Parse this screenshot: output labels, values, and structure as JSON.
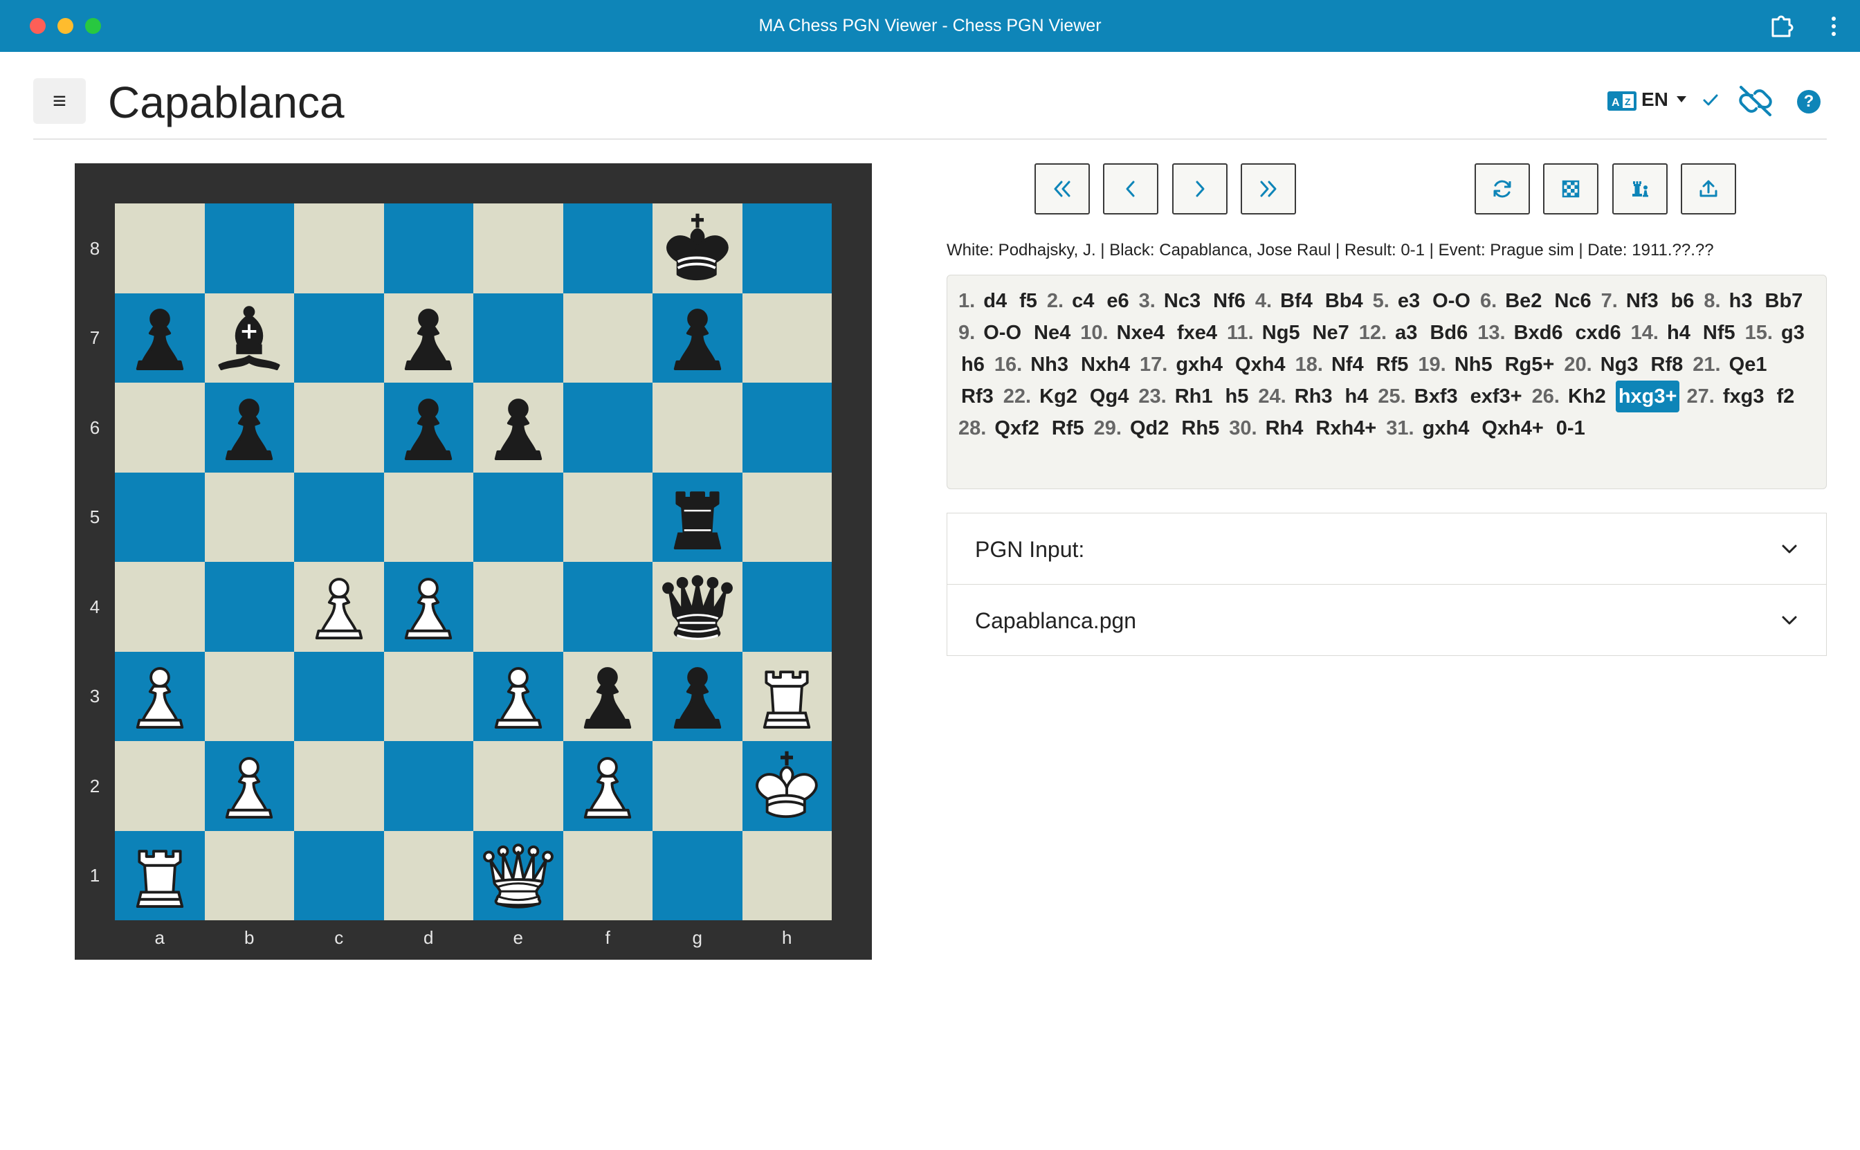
{
  "window": {
    "title": "MA Chess PGN Viewer - Chess PGN Viewer"
  },
  "header": {
    "menu_glyph": "≡",
    "title": "Capablanca",
    "language": "EN",
    "help_glyph": "?"
  },
  "board": {
    "files": [
      "a",
      "b",
      "c",
      "d",
      "e",
      "f",
      "g",
      "h"
    ],
    "ranks": [
      "8",
      "7",
      "6",
      "5",
      "4",
      "3",
      "2",
      "1"
    ],
    "pieces": {
      "g8": "bK",
      "a7": "bP",
      "b7": "bB",
      "d7": "bP",
      "g7": "bP",
      "b6": "bP",
      "d6": "bP",
      "e6": "bP",
      "g5": "bR",
      "c4": "wP",
      "d4": "wP",
      "g4": "bQ",
      "a3": "wP",
      "e3": "wP",
      "f3": "bP",
      "g3": "bP",
      "h3": "wR",
      "b2": "wP",
      "f2": "wP",
      "h2": "wK",
      "a1": "wR",
      "e1": "wQ"
    },
    "colors": {
      "light": "#dcdcc8",
      "dark": "#0c82b8",
      "frame": "#303030"
    }
  },
  "toolbar": {
    "buttons": [
      "first-move",
      "previous-move",
      "next-move",
      "last-move",
      "flip-board",
      "board-theme",
      "piece-set",
      "export"
    ]
  },
  "game_info": "White: Podhajsky, J. | Black: Capablanca, Jose Raul | Result: 0-1 | Event: Prague sim | Date: 1911.??.??",
  "moves": [
    {
      "n": "1.",
      "w": "d4",
      "b": "f5"
    },
    {
      "n": "2.",
      "w": "c4",
      "b": "e6"
    },
    {
      "n": "3.",
      "w": "Nc3",
      "b": "Nf6"
    },
    {
      "n": "4.",
      "w": "Bf4",
      "b": "Bb4"
    },
    {
      "n": "5.",
      "w": "e3",
      "b": "O-O"
    },
    {
      "n": "6.",
      "w": "Be2",
      "b": "Nc6"
    },
    {
      "n": "7.",
      "w": "Nf3",
      "b": "b6"
    },
    {
      "n": "8.",
      "w": "h3",
      "b": "Bb7"
    },
    {
      "n": "9.",
      "w": "O-O",
      "b": "Ne4"
    },
    {
      "n": "10.",
      "w": "Nxe4",
      "b": "fxe4"
    },
    {
      "n": "11.",
      "w": "Ng5",
      "b": "Ne7"
    },
    {
      "n": "12.",
      "w": "a3",
      "b": "Bd6"
    },
    {
      "n": "13.",
      "w": "Bxd6",
      "b": "cxd6"
    },
    {
      "n": "14.",
      "w": "h4",
      "b": "Nf5"
    },
    {
      "n": "15.",
      "w": "g3",
      "b": "h6"
    },
    {
      "n": "16.",
      "w": "Nh3",
      "b": "Nxh4"
    },
    {
      "n": "17.",
      "w": "gxh4",
      "b": "Qxh4"
    },
    {
      "n": "18.",
      "w": "Nf4",
      "b": "Rf5"
    },
    {
      "n": "19.",
      "w": "Nh5",
      "b": "Rg5+"
    },
    {
      "n": "20.",
      "w": "Ng3",
      "b": "Rf8"
    },
    {
      "n": "21.",
      "w": "Qe1",
      "b": "Rf3"
    },
    {
      "n": "22.",
      "w": "Kg2",
      "b": "Qg4"
    },
    {
      "n": "23.",
      "w": "Rh1",
      "b": "h5"
    },
    {
      "n": "24.",
      "w": "Rh3",
      "b": "h4"
    },
    {
      "n": "25.",
      "w": "Bxf3",
      "b": "exf3+"
    },
    {
      "n": "26.",
      "w": "Kh2",
      "b": "hxg3+"
    },
    {
      "n": "27.",
      "w": "fxg3",
      "b": "f2"
    },
    {
      "n": "28.",
      "w": "Qxf2",
      "b": "Rf5"
    },
    {
      "n": "29.",
      "w": "Qd2",
      "b": "Rh5"
    },
    {
      "n": "30.",
      "w": "Rh4",
      "b": "Rxh4+"
    },
    {
      "n": "31.",
      "w": "gxh4",
      "b": "Qxh4+"
    }
  ],
  "current_move": "hxg3+",
  "result": "0-1",
  "panels": [
    {
      "label": "PGN Input:"
    },
    {
      "label": "Capablanca.pgn"
    }
  ]
}
